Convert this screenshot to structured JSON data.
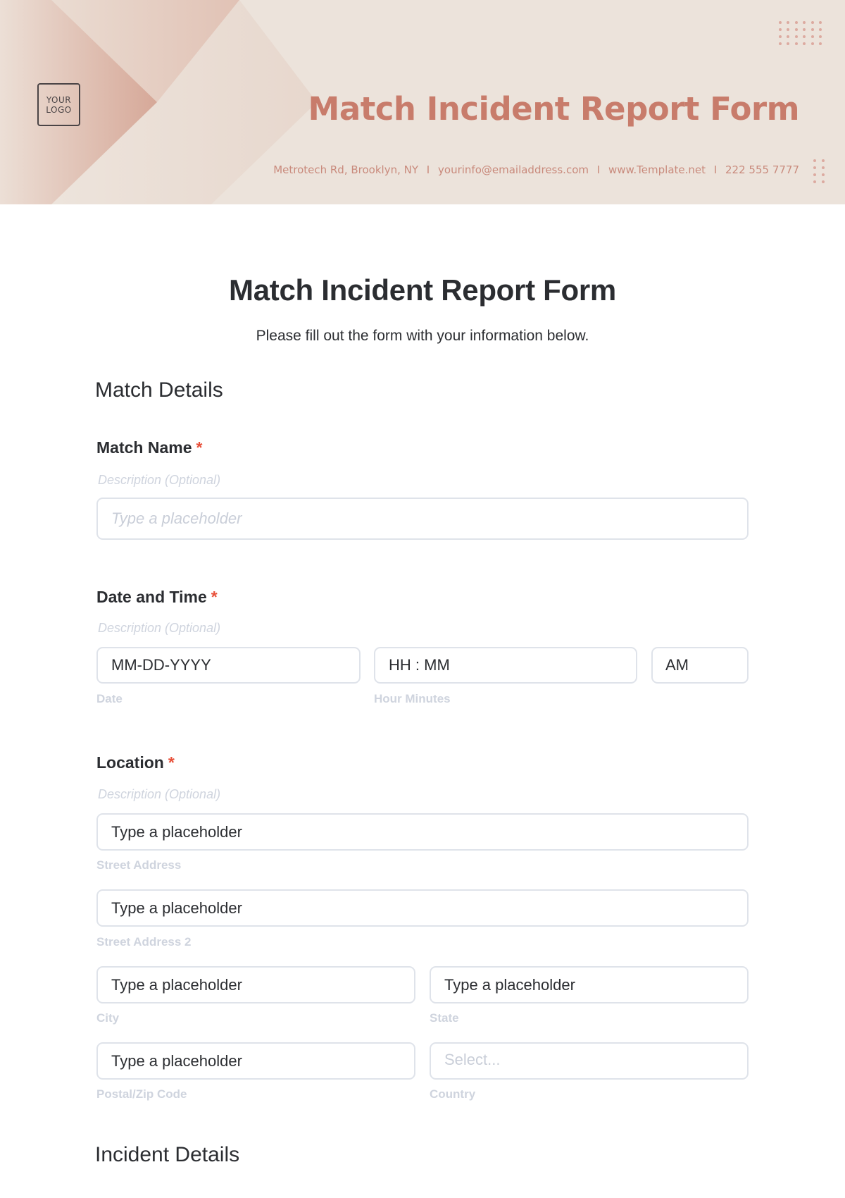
{
  "header": {
    "logo_line1": "YOUR",
    "logo_line2": "LOGO",
    "title": "Match Incident Report Form",
    "contact": {
      "address": "Metrotech Rd, Brooklyn, NY",
      "email": "yourinfo@emailaddress.com",
      "website": "www.Template.net",
      "phone": "222 555 7777",
      "separator": "I"
    },
    "colors": {
      "accent": "#c87c6b",
      "background": "#ece3db",
      "chevron_dark": "#d4a596"
    }
  },
  "form": {
    "title": "Match Incident Report Form",
    "subtitle": "Please fill out the form with your information below.",
    "sections": [
      {
        "heading": "Match Details"
      },
      {
        "heading": "Incident Details"
      }
    ],
    "fields": {
      "match_name": {
        "label": "Match Name",
        "required_mark": "*",
        "description": "Description (Optional)",
        "placeholder": "Type a placeholder"
      },
      "date_time": {
        "label": "Date and Time",
        "required_mark": "*",
        "description": "Description (Optional)",
        "date_value": "MM-DD-YYYY",
        "date_sublabel": "Date",
        "time_value": "HH : MM",
        "time_sublabel": "Hour Minutes",
        "ampm_value": "AM"
      },
      "location": {
        "label": "Location",
        "required_mark": "*",
        "description": "Description (Optional)",
        "street_value": "Type a placeholder",
        "street_sublabel": "Street Address",
        "street2_value": "Type a placeholder",
        "street2_sublabel": "Street Address 2",
        "city_value": "Type a placeholder",
        "city_sublabel": "City",
        "state_value": "Type a placeholder",
        "state_sublabel": "State",
        "zip_value": "Type a placeholder",
        "zip_sublabel": "Postal/Zip Code",
        "country_placeholder": "Select...",
        "country_sublabel": "Country"
      }
    }
  }
}
